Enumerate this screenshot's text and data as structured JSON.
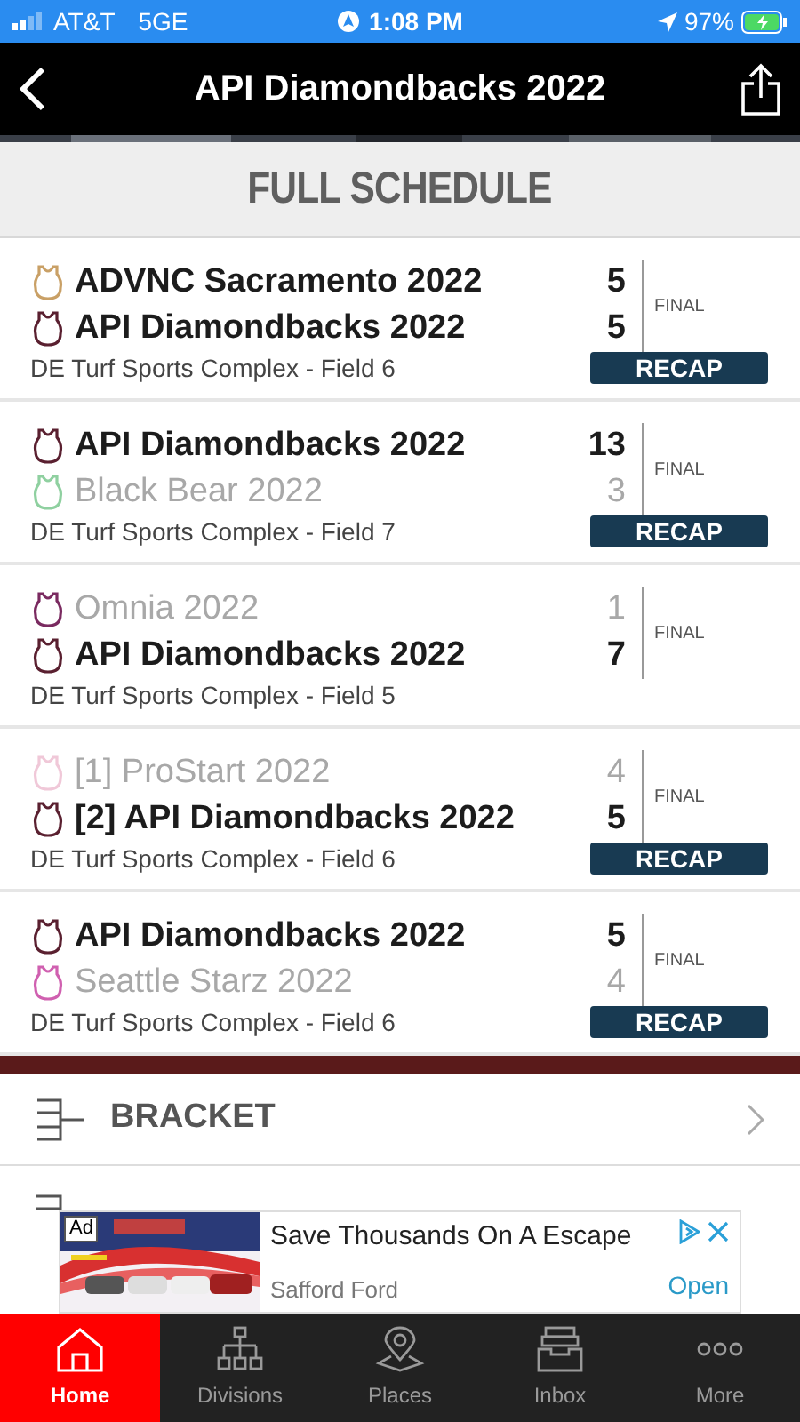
{
  "status_bar": {
    "carrier": "AT&T",
    "network": "5GE",
    "time": "1:08 PM",
    "battery": "97%"
  },
  "nav": {
    "title": "API Diamondbacks 2022"
  },
  "section_title": "FULL SCHEDULE",
  "games": [
    {
      "teams": [
        {
          "name": "ADVNC Sacramento 2022",
          "score": "5",
          "winner": true,
          "color": "#c9a066"
        },
        {
          "name": "API Diamondbacks 2022",
          "score": "5",
          "winner": true,
          "color": "#5a2030"
        }
      ],
      "venue": "DE Turf  Sports Complex - Field 6",
      "status": "FINAL",
      "recap": "RECAP"
    },
    {
      "teams": [
        {
          "name": "API Diamondbacks 2022",
          "score": "13",
          "winner": true,
          "color": "#5a2030"
        },
        {
          "name": "Black Bear 2022",
          "score": "3",
          "winner": false,
          "color": "#8fd0a0"
        }
      ],
      "venue": "DE Turf  Sports Complex - Field 7",
      "status": "FINAL",
      "recap": "RECAP"
    },
    {
      "teams": [
        {
          "name": "Omnia 2022",
          "score": "1",
          "winner": false,
          "color": "#7a2a60"
        },
        {
          "name": "API Diamondbacks 2022",
          "score": "7",
          "winner": true,
          "color": "#5a2030"
        }
      ],
      "venue": "DE Turf  Sports Complex - Field 5",
      "status": "FINAL"
    },
    {
      "teams": [
        {
          "name": "[1] ProStart 2022",
          "score": "4",
          "winner": false,
          "color": "#f0c8d8"
        },
        {
          "name": "[2] API Diamondbacks 2022",
          "score": "5",
          "winner": true,
          "color": "#5a2030"
        }
      ],
      "venue": "DE Turf  Sports Complex - Field 6",
      "status": "FINAL",
      "recap": "RECAP"
    },
    {
      "teams": [
        {
          "name": "API Diamondbacks 2022",
          "score": "5",
          "winner": true,
          "color": "#5a2030"
        },
        {
          "name": "Seattle Starz 2022",
          "score": "4",
          "winner": false,
          "color": "#d060b0"
        }
      ],
      "venue": "DE Turf  Sports Complex - Field 6",
      "status": "FINAL",
      "recap": "RECAP"
    }
  ],
  "links": [
    {
      "label": "BRACKET"
    }
  ],
  "ad": {
    "badge": "Ad",
    "title": "Save Thousands On A Escape",
    "advertiser": "Safford Ford",
    "action": "Open"
  },
  "tabs": [
    {
      "label": "Home",
      "kind": "home",
      "selected": true
    },
    {
      "label": "Divisions",
      "kind": "divisions",
      "selected": false
    },
    {
      "label": "Places",
      "kind": "places",
      "selected": false
    },
    {
      "label": "Inbox",
      "kind": "inbox",
      "selected": false
    },
    {
      "label": "More",
      "kind": "more",
      "selected": false
    }
  ]
}
